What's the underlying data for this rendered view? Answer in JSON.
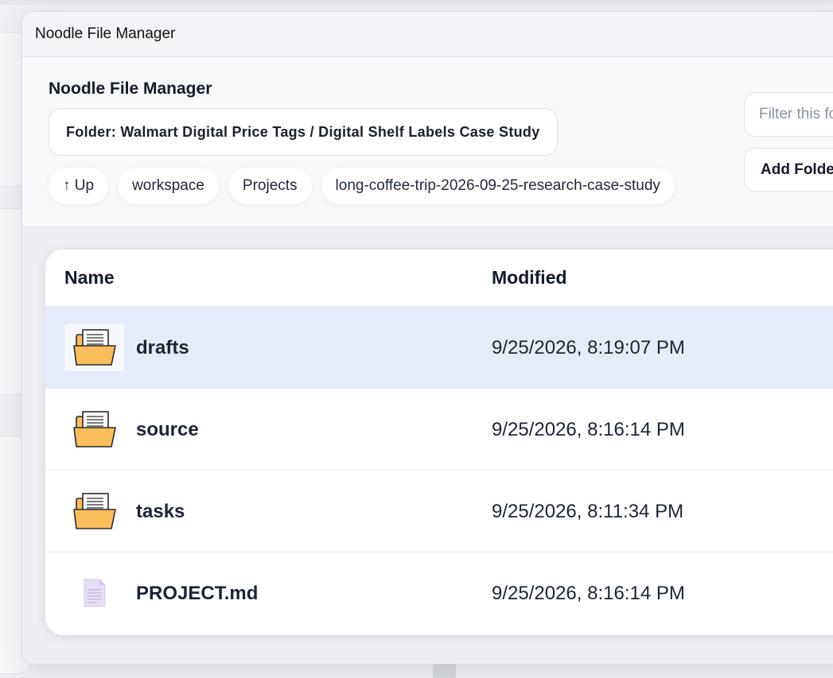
{
  "window": {
    "title": "Noodle File Manager"
  },
  "header": {
    "app_title": "Noodle File Manager",
    "folder_path": "Folder: Walmart Digital Price Tags / Digital Shelf Labels Case Study",
    "breadcrumbs": [
      {
        "label": "↑ Up"
      },
      {
        "label": "workspace"
      },
      {
        "label": "Projects"
      },
      {
        "label": "long-coffee-trip-2026-09-25-research-case-study"
      }
    ],
    "filter_placeholder": "Filter this folder",
    "add_folder_label": "Add Folder"
  },
  "list": {
    "columns": {
      "name": "Name",
      "modified": "Modified"
    },
    "rows": [
      {
        "name": "drafts",
        "modified": "9/25/2026, 8:19:07 PM",
        "type": "folder",
        "icon": "folder-open-icon",
        "selected": true
      },
      {
        "name": "source",
        "modified": "9/25/2026, 8:16:14 PM",
        "type": "folder",
        "icon": "folder-open-icon",
        "selected": false
      },
      {
        "name": "tasks",
        "modified": "9/25/2026, 8:11:34 PM",
        "type": "folder",
        "icon": "folder-open-icon",
        "selected": false
      },
      {
        "name": "PROJECT.md",
        "modified": "9/25/2026, 8:16:14 PM",
        "type": "file",
        "icon": "document-icon",
        "selected": false
      }
    ]
  },
  "colors": {
    "selected_row": "#e6ebfa",
    "folder_fill": "#f9bd5c",
    "document_fill": "#e6def2"
  }
}
